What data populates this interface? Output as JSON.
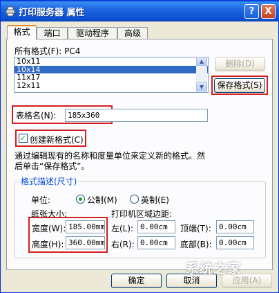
{
  "window": {
    "title": "打印服务器 属性",
    "help_label": "?",
    "close_label": "X"
  },
  "tabs": [
    {
      "label": "格式"
    },
    {
      "label": "端口"
    },
    {
      "label": "驱动程序"
    },
    {
      "label": "高级"
    }
  ],
  "formats": {
    "header": "所有格式(F): PC4",
    "items": [
      "10x11",
      "10x14",
      "11x17",
      "12x11"
    ],
    "selected": "10x14",
    "delete_label": "删除(D)",
    "save_label": "保存格式(S)"
  },
  "form_name": {
    "label": "表格名(N):",
    "value": "185x360"
  },
  "create_new": {
    "label": "创建新格式(C)",
    "checked": true
  },
  "description": {
    "line1": "通过编辑现有的名称和度量单位来定义新的格式。然",
    "line2": "后单击“保存格式”。"
  },
  "format_desc": {
    "title": "格式描述(尺寸)",
    "unit_label": "单位:",
    "metric_label": "公制(M)",
    "english_label": "英制(E)",
    "unit_selected": "metric",
    "paper_size_label": "纸张大小:",
    "width_label": "宽度(W):",
    "width_value": "185.00mm",
    "height_label": "高度(H):",
    "height_value": "360.00mm",
    "margins_label": "打印机区域边距:",
    "left_label": "左(L):",
    "left_value": "0.00cm",
    "right_label": "右(R):",
    "right_value": "0.00cm",
    "top_label": "顶端(T):",
    "top_value": "0.00cm",
    "bottom_label": "底部(B):",
    "bottom_value": "0.00cm"
  },
  "footer": {
    "ok_label": "确定",
    "cancel_label": "取消",
    "apply_label": "应用(A)"
  },
  "watermark": "系统之家",
  "colors": {
    "titlebar": "#0a4fd0",
    "selection": "#316ac5",
    "highlight_box": "#d21f1f",
    "group_title": "#0046d5"
  }
}
